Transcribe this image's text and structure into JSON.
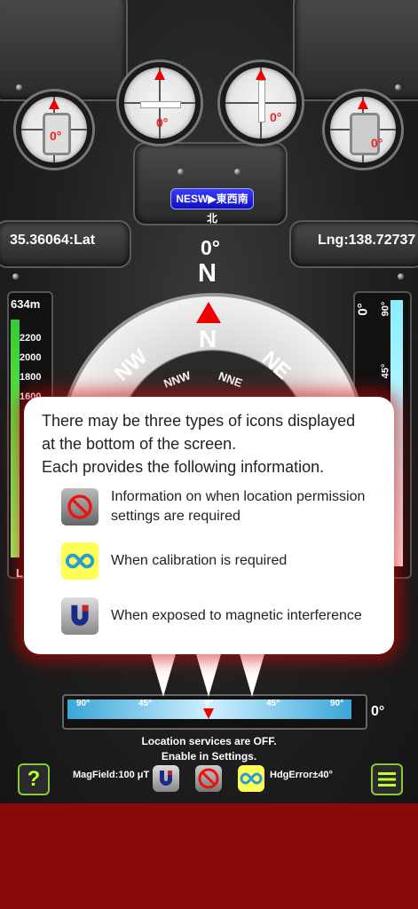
{
  "gauges": {
    "g1_deg": "0°",
    "g2_deg": "0°",
    "g3_deg": "0°",
    "g4_deg": "0°"
  },
  "badge": {
    "label": "NESW▶東西南北"
  },
  "coords": {
    "lat": "35.36064:Lat",
    "lng": "Lng:138.72737"
  },
  "heading": {
    "degrees": "0°",
    "cardinal": "N"
  },
  "dial": {
    "n": "N",
    "nw": "NW",
    "ne": "NE",
    "nnw": "NNW",
    "nne": "NNE"
  },
  "altitude": {
    "value": "634m",
    "ticks": [
      "2200",
      "2000",
      "1800",
      "1600"
    ],
    "bottom_label": "L"
  },
  "pitch": {
    "top": "0°",
    "mid_top": "90°",
    "mid": "45°"
  },
  "modal": {
    "intro_line1": "There may be three types of icons displayed",
    "intro_line2": "at the bottom of the screen.",
    "intro_line3": "Each provides the following information.",
    "item1": "Information on when location permission settings are required",
    "item2": "When calibration is required",
    "item3": "When exposed to magnetic interference"
  },
  "hbar": {
    "l90": "90°",
    "l45": "45°",
    "c0": "0°",
    "r45": "45°",
    "r90": "90°",
    "readout": "0°"
  },
  "status": {
    "line1": "Location services are OFF.",
    "line2": "Enable in Settings."
  },
  "footer": {
    "help": "?",
    "magfield": "MagField:100 μT",
    "hdgerror": "HdgError±40°"
  }
}
